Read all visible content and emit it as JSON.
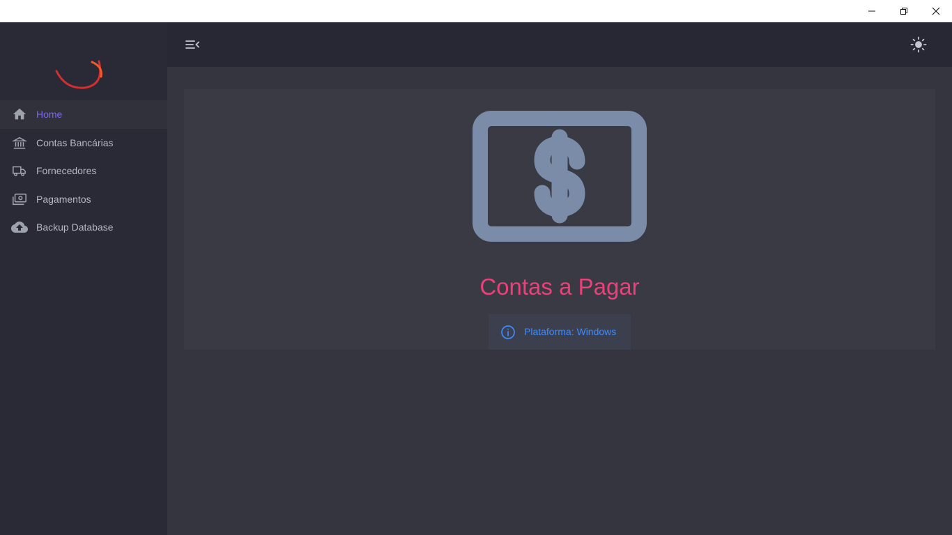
{
  "window": {
    "controls": [
      "minimize-icon",
      "maximize-icon",
      "close-icon"
    ]
  },
  "sidebar": {
    "items": [
      {
        "label": "Home",
        "icon": "home-icon",
        "active": true
      },
      {
        "label": "Contas Bancárias",
        "icon": "bank-icon",
        "active": false
      },
      {
        "label": "Fornecedores",
        "icon": "truck-icon",
        "active": false
      },
      {
        "label": "Pagamentos",
        "icon": "payments-icon",
        "active": false
      },
      {
        "label": "Backup Database",
        "icon": "cloud-upload-icon",
        "active": false
      }
    ]
  },
  "topbar": {
    "menu_icon": "menu-collapse-icon",
    "theme_icon": "sun-icon"
  },
  "main": {
    "hero_icon": "dollar-bill-icon",
    "title": "Contas a Pagar",
    "platform": "Plataforma: Windows"
  },
  "colors": {
    "accent": "#7b68ee",
    "title": "#ec407a",
    "info": "#3d8bfd",
    "icon_gray": "#7a8ca7",
    "logo_red": "#e53920"
  }
}
